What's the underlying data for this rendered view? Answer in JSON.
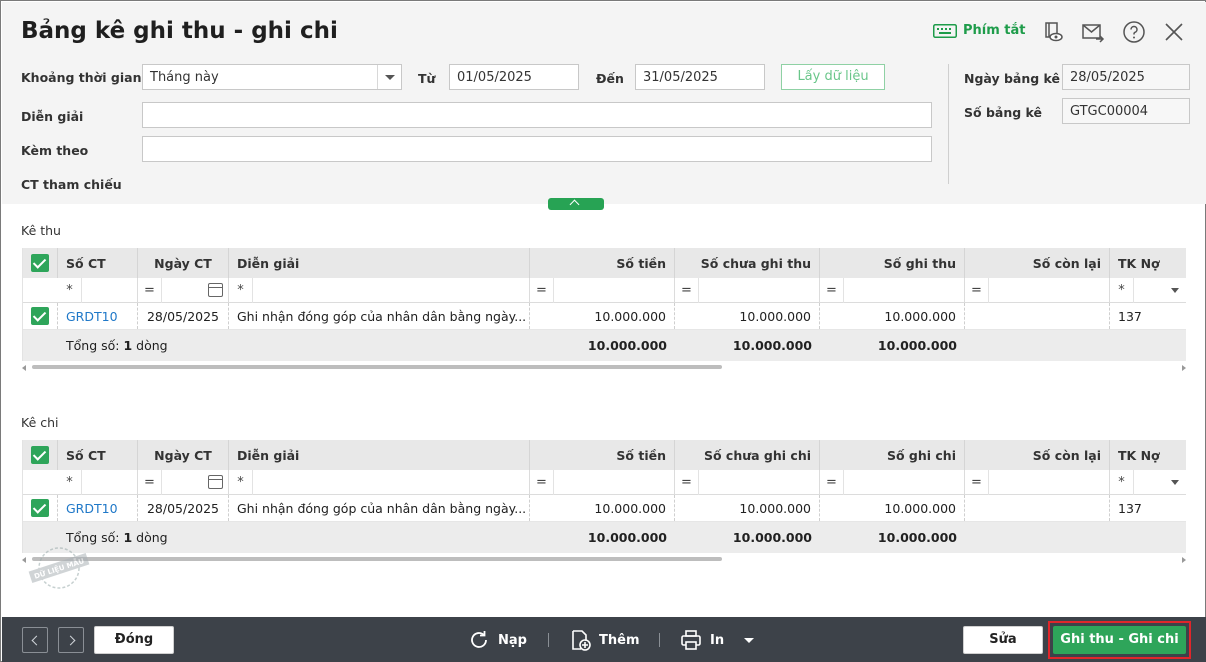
{
  "window": {
    "title": "Bảng kê ghi thu - ghi chi"
  },
  "header": {
    "shortcut_label": "Phím tắt"
  },
  "form": {
    "period_label": "Khoảng thời gian",
    "period_value": "Tháng này",
    "from_label": "Từ",
    "from_value": "01/05/2025",
    "to_label": "Đến",
    "to_value": "31/05/2025",
    "fetch_button": "Lấy dữ liệu",
    "description_label": "Diễn giải",
    "description_value": "",
    "attached_label": "Kèm theo",
    "attached_value": "",
    "reference_label": "CT tham chiếu",
    "list_date_label": "Ngày bảng kê",
    "list_date_value": "28/05/2025",
    "list_no_label": "Số bảng kê",
    "list_no_value": "GTGC00004"
  },
  "income": {
    "title": "Kê thu",
    "columns": [
      "Số CT",
      "Ngày CT",
      "Diễn giải",
      "Số tiền",
      "Số chưa ghi thu",
      "Số ghi thu",
      "Số còn lại",
      "TK Nợ"
    ],
    "filters": {
      "star": "*",
      "eq": "="
    },
    "row": {
      "doc_no": "GRDT10",
      "date": "28/05/2025",
      "desc": "Ghi nhận đóng góp của nhân dân bằng ngày...",
      "amount": "10.000.000",
      "unrecorded": "10.000.000",
      "recorded": "10.000.000",
      "remaining": "",
      "debit": "137"
    },
    "total": {
      "prefix": "Tổng số: ",
      "count": "1",
      "suffix": " dòng",
      "amount": "10.000.000",
      "unrecorded": "10.000.000",
      "recorded": "10.000.000"
    }
  },
  "expense": {
    "title": "Kê chi",
    "columns": [
      "Số CT",
      "Ngày CT",
      "Diễn giải",
      "Số tiền",
      "Số chưa ghi chi",
      "Số ghi chi",
      "Số còn lại",
      "TK Nợ"
    ],
    "filters": {
      "star": "*",
      "eq": "="
    },
    "row": {
      "doc_no": "GRDT10",
      "date": "28/05/2025",
      "desc": "Ghi nhận đóng góp của nhân dân bằng ngày...",
      "amount": "10.000.000",
      "unrecorded": "10.000.000",
      "recorded": "10.000.000",
      "remaining": "",
      "debit": "137"
    },
    "total": {
      "prefix": "Tổng số: ",
      "count": "1",
      "suffix": " dòng",
      "amount": "10.000.000",
      "unrecorded": "10.000.000",
      "recorded": "10.000.000"
    }
  },
  "footer": {
    "close_label": "Đóng",
    "reload_label": "Nạp",
    "add_label": "Thêm",
    "print_label": "In",
    "edit_label": "Sửa",
    "primary_label": "Ghi thu - Ghi chi"
  },
  "watermark": {
    "text": "DỮ LIỆU MẪU"
  },
  "colors": {
    "accent": "#2ea55a",
    "link": "#1f78c8",
    "footer_bg": "#3d4249",
    "highlight": "#e0262b"
  }
}
